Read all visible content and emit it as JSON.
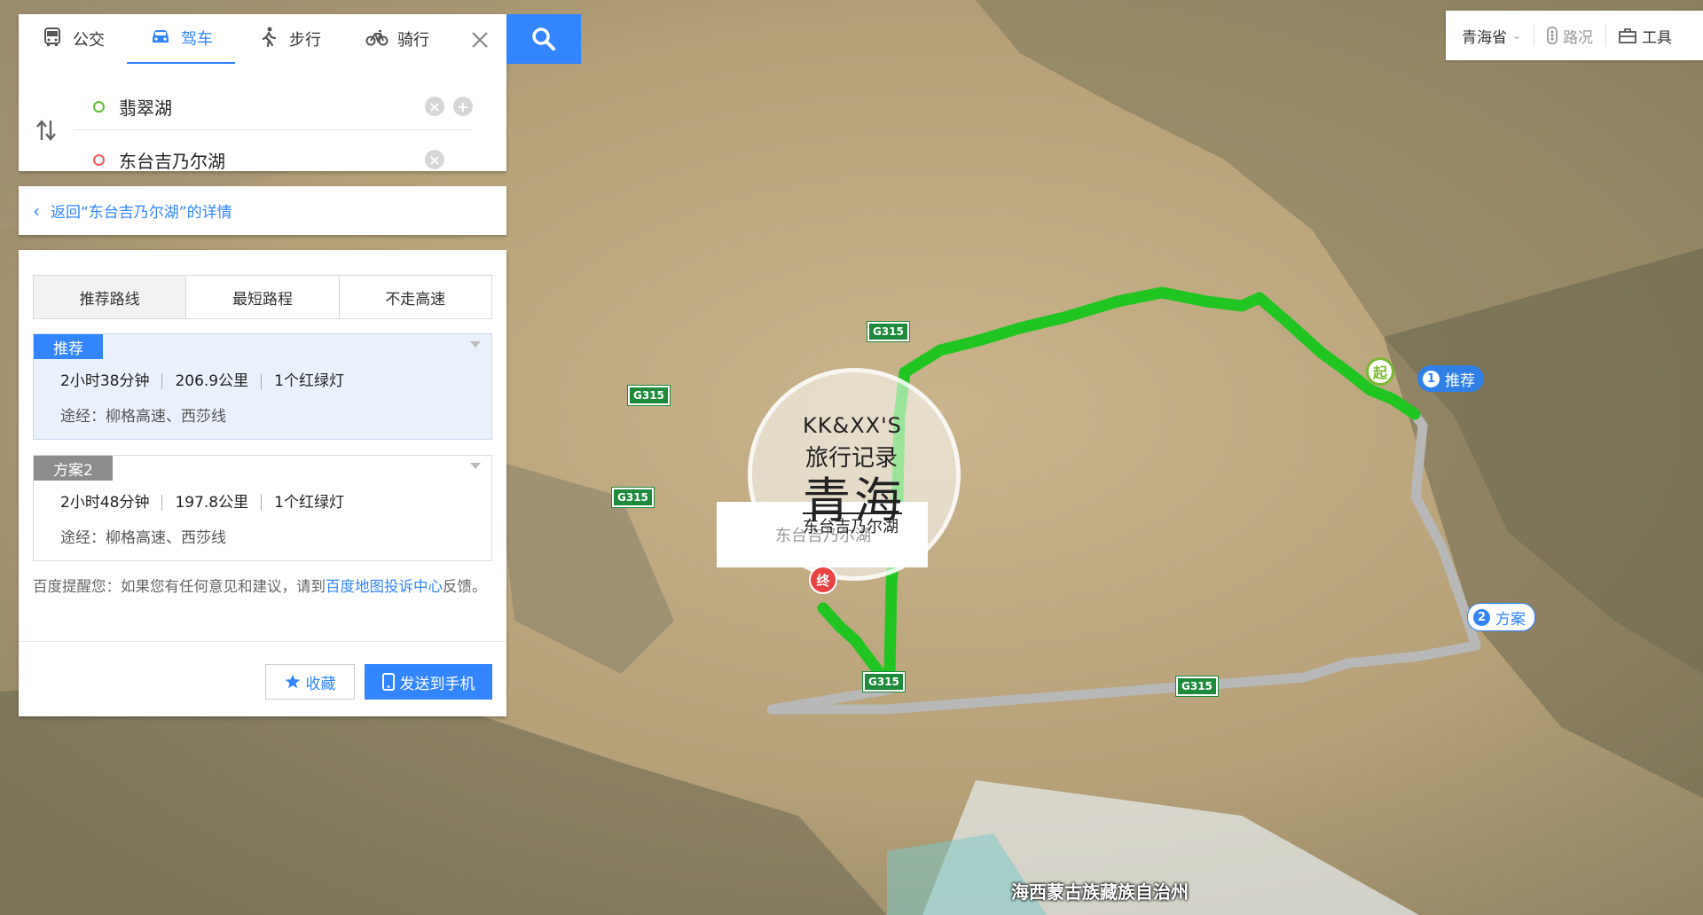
{
  "mode_tabs": [
    {
      "label": "公交",
      "icon": "bus-icon"
    },
    {
      "label": "驾车",
      "icon": "car-icon",
      "active": true
    },
    {
      "label": "步行",
      "icon": "walk-icon"
    },
    {
      "label": "骑行",
      "icon": "bike-icon"
    }
  ],
  "start_value": "翡翠湖",
  "end_value": "东台吉乃尔湖",
  "back_link": "返回“东台吉乃尔湖”的详情",
  "route_tabs": [
    "推荐路线",
    "最短路程",
    "不走高速"
  ],
  "plans": [
    {
      "tag": "推荐",
      "duration": "2小时38分钟",
      "distance": "206.9公里",
      "lights": "1个红绿灯",
      "via": "途经：柳格高速、西莎线"
    },
    {
      "tag": "方案2",
      "duration": "2小时48分钟",
      "distance": "197.8公里",
      "lights": "1个红绿灯",
      "via": "途经：柳格高速、西莎线"
    }
  ],
  "tip": {
    "prefix": "百度提醒您：如果您有任何意见和建议，请到",
    "link": "百度地图投诉中心",
    "suffix": "反馈。"
  },
  "buttons": {
    "favorite": "收藏",
    "send": "发送到手机"
  },
  "toolbar": {
    "province": "青海省",
    "traffic": "路况",
    "tools": "工具"
  },
  "map": {
    "highway_shield": "G315",
    "route1_label": "推荐",
    "route2_label": "方案",
    "route1_num": "1",
    "route2_num": "2",
    "start_marker": "起",
    "end_marker": "终",
    "place_label": "东台吉乃尔湖",
    "region_label": "海西蒙古族藏族自治州",
    "watermark": {
      "brand": "KK&XX'S",
      "line1": "旅行记录",
      "line2": "青海",
      "line3": "东台吉乃尔湖"
    }
  },
  "colors": {
    "accent": "#3385ff",
    "route_primary": "#21c521",
    "route_alt": "#b8b8b8"
  }
}
